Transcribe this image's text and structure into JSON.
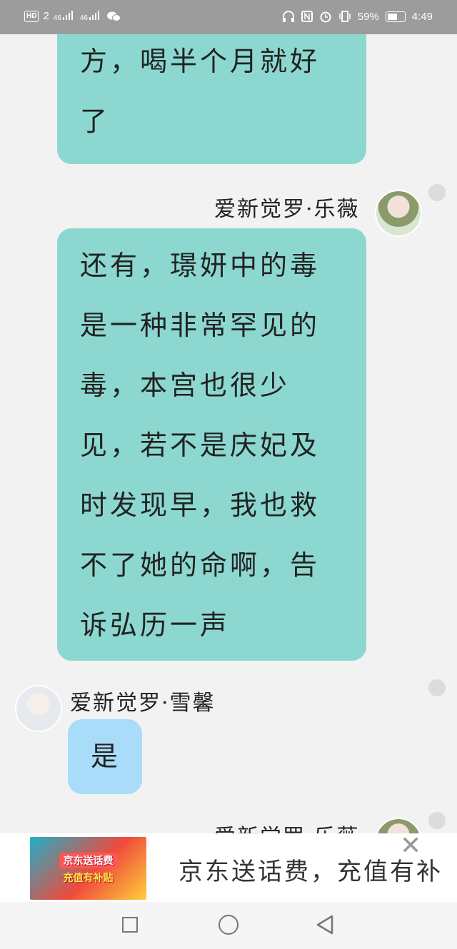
{
  "status_bar": {
    "hd": "HD",
    "sim": "2",
    "signal1": "46",
    "signal2": "46",
    "battery_text": "59%",
    "battery_level": 0.59,
    "time": "4:49"
  },
  "messages": [
    {
      "side": "left",
      "bubble_color": "#8cd8d0",
      "text": "方，喝半个月就好了"
    },
    {
      "side": "right-sender",
      "name": "爱新觉罗·乐薇",
      "bubble_color": "#8cd8d0",
      "text": "还有，璟妍中的毒是一种非常罕见的毒，本宫也很少见，若不是庆妃及时发现早，我也救不了她的命啊，告诉弘历一声"
    },
    {
      "side": "left-sender",
      "name": "爱新觉罗·雪馨",
      "bubble_color": "#a8dcf8",
      "text": "是"
    },
    {
      "side": "right-sender",
      "name": "爱新觉罗·乐薇"
    }
  ],
  "ad": {
    "image_title": "京东送话费",
    "image_subtitle": "充值有补贴",
    "text": "京东送话费，充值有补贴",
    "close_icon": "close-icon"
  },
  "nav": {
    "icons": [
      "recent-apps-icon",
      "home-icon",
      "back-icon"
    ]
  }
}
